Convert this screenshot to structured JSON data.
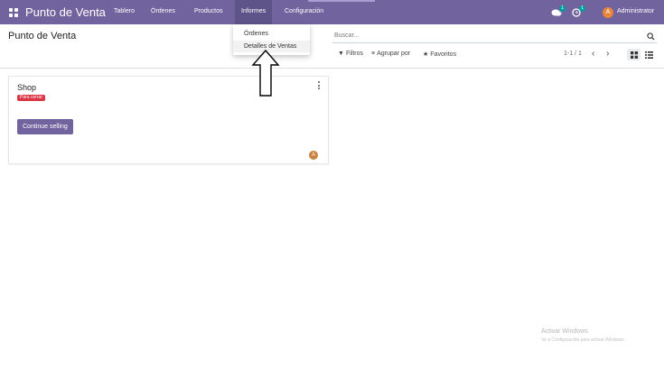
{
  "navbar": {
    "app_title": "Punto de Venta",
    "menu": [
      "Tablero",
      "Órdenes",
      "Productos",
      "Informes",
      "Configuración"
    ],
    "open_menu": "Informes",
    "messages_count": "1",
    "activities_count": "1",
    "user_initial": "A",
    "user_name": "Administrator",
    "colors": {
      "bar": "#71639e",
      "badge": "#00a09d",
      "avatar": "#e8873b"
    }
  },
  "dropdown": {
    "items": [
      "Órdenes",
      "Detalles de Ventas"
    ],
    "highlighted": "Detalles de Ventas"
  },
  "control_panel": {
    "title": "Punto de Venta",
    "search_placeholder": "Buscar...",
    "filters_label": "Filtros",
    "group_by_label": "Agrupar por",
    "favorites_label": "Favoritos",
    "pager": "1-1 / 1",
    "views": [
      "kanban-view-icon",
      "list-view-icon"
    ],
    "active_view": "kanban"
  },
  "card": {
    "title": "Shop",
    "status": "Para cerrar",
    "button_label": "Continue selling",
    "avatar_initial": "A",
    "colors": {
      "status": "#dc3545",
      "button": "#71639e"
    }
  },
  "watermark": {
    "title": "Activar Windows",
    "subtitle": "Ve a Configuración para activar Windows."
  }
}
